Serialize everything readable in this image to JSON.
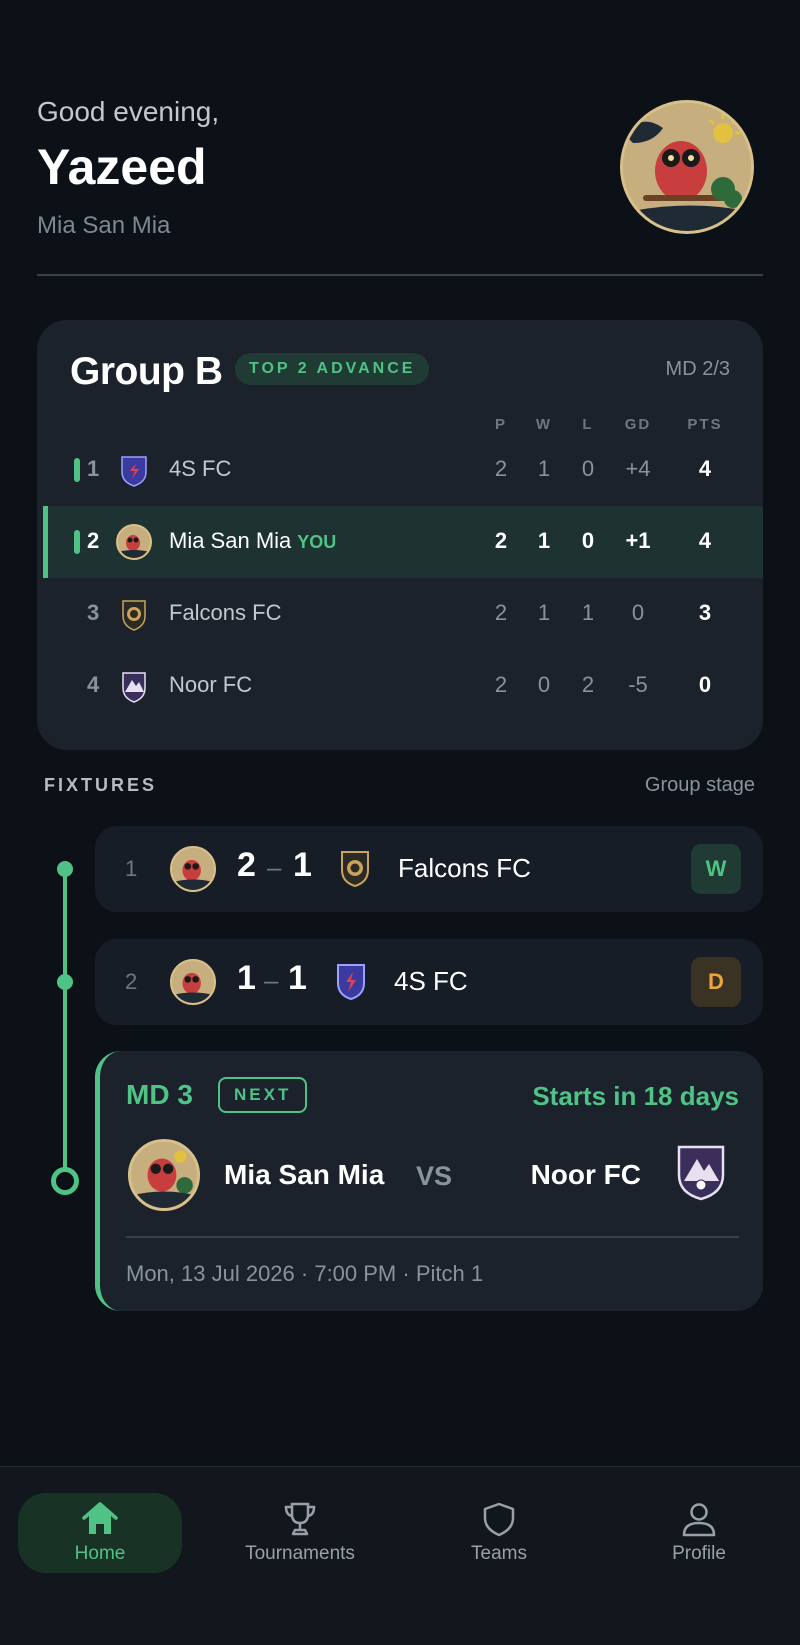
{
  "header": {
    "greeting": "Good evening,",
    "name": "Yazeed",
    "team": "Mia San Mia"
  },
  "group": {
    "title": "Group B",
    "badge": "TOP 2 ADVANCE",
    "matchday": "MD 2/3",
    "columns": [
      "P",
      "W",
      "L",
      "GD",
      "PTS"
    ],
    "rows": [
      {
        "pos": "1",
        "name": "4S FC",
        "you": "",
        "p": "2",
        "w": "1",
        "l": "0",
        "gd": "+4",
        "pts": "4"
      },
      {
        "pos": "2",
        "name": "Mia San Mia",
        "you": "YOU",
        "p": "2",
        "w": "1",
        "l": "0",
        "gd": "+1",
        "pts": "4"
      },
      {
        "pos": "3",
        "name": "Falcons FC",
        "you": "",
        "p": "2",
        "w": "1",
        "l": "1",
        "gd": "0",
        "pts": "3"
      },
      {
        "pos": "4",
        "name": "Noor FC",
        "you": "",
        "p": "2",
        "w": "0",
        "l": "2",
        "gd": "-5",
        "pts": "0"
      }
    ]
  },
  "fixtures": {
    "label": "FIXTURES",
    "stage": "Group stage",
    "played": [
      {
        "md": "1",
        "home_score": "2",
        "away_score": "1",
        "opponent": "Falcons FC",
        "result": "W"
      },
      {
        "md": "2",
        "home_score": "1",
        "away_score": "1",
        "opponent": "4S FC",
        "result": "D"
      }
    ],
    "next": {
      "md": "MD 3",
      "badge": "NEXT",
      "countdown": "Starts in 18 days",
      "home": "Mia San Mia",
      "vs": "VS",
      "away": "Noor FC",
      "meta": "Mon, 13 Jul 2026 · 7:00 PM · Pitch 1"
    }
  },
  "nav": [
    {
      "label": "Home",
      "icon": "home-icon",
      "active": true
    },
    {
      "label": "Tournaments",
      "icon": "trophy-icon",
      "active": false
    },
    {
      "label": "Teams",
      "icon": "shield-icon",
      "active": false
    },
    {
      "label": "Profile",
      "icon": "person-icon",
      "active": false
    }
  ],
  "colors": {
    "background": "#0c1118",
    "card": "#1b222c",
    "accent": "#4fc386",
    "draw": "#f0a53a"
  }
}
